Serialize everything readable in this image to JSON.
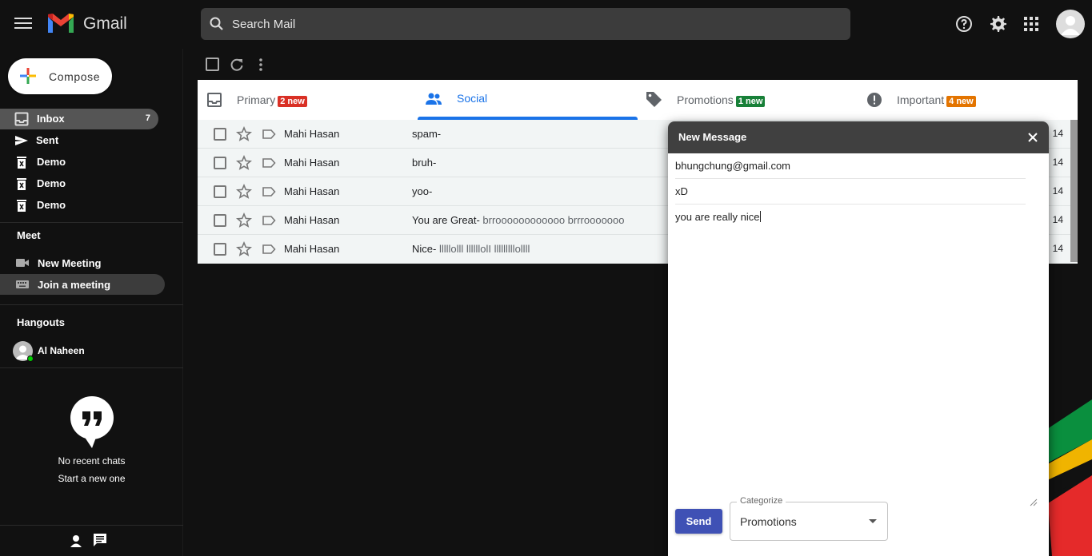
{
  "header": {
    "brand": "Gmail",
    "search_placeholder": "Search Mail"
  },
  "sidebar": {
    "compose_label": "Compose",
    "items": [
      {
        "label": "Inbox",
        "count": "7",
        "icon": "inbox-icon"
      },
      {
        "label": "Sent",
        "count": "",
        "icon": "send-icon"
      },
      {
        "label": "Demo",
        "count": "",
        "icon": "trash-icon"
      },
      {
        "label": "Demo",
        "count": "",
        "icon": "trash-icon"
      },
      {
        "label": "Demo",
        "count": "",
        "icon": "trash-icon"
      }
    ],
    "meet": {
      "title": "Meet",
      "new_meeting": "New Meeting",
      "join_meeting": "Join a meeting"
    },
    "hangouts": {
      "title": "Hangouts",
      "user_name": "Al Naheen",
      "no_chats": "No recent chats",
      "start_new": "Start a new one"
    }
  },
  "tabs": [
    {
      "label": "Primary",
      "badge": "2 new",
      "badge_color": "#d93025"
    },
    {
      "label": "Social",
      "badge": "",
      "badge_color": ""
    },
    {
      "label": "Promotions",
      "badge": "1 new",
      "badge_color": "#188038"
    },
    {
      "label": "Important",
      "badge": "4 new",
      "badge_color": "#e37400"
    }
  ],
  "emails": [
    {
      "sender": "Mahi Hasan",
      "subject": "spam-",
      "snippet": "",
      "date": "14"
    },
    {
      "sender": "Mahi Hasan",
      "subject": "bruh-",
      "snippet": "",
      "date": "14"
    },
    {
      "sender": "Mahi Hasan",
      "subject": "yoo-",
      "snippet": "",
      "date": "14"
    },
    {
      "sender": "Mahi Hasan",
      "subject": "You are Great-",
      "snippet": " brroooooooooooo brrrooooooo",
      "date": "14"
    },
    {
      "sender": "Mahi Hasan",
      "subject": "Nice-",
      "snippet": " lllllolll llllllolI lllllllllollll",
      "date": "14"
    }
  ],
  "compose_window": {
    "title": "New Message",
    "to": "bhungchung@gmail.com",
    "subject": "xD",
    "body": "you are really nice",
    "send_label": "Send",
    "categorize_label": "Categorize",
    "categorize_value": "Promotions"
  },
  "colors": {
    "accent": "#1a73e8",
    "send_button": "#3f51b5"
  }
}
